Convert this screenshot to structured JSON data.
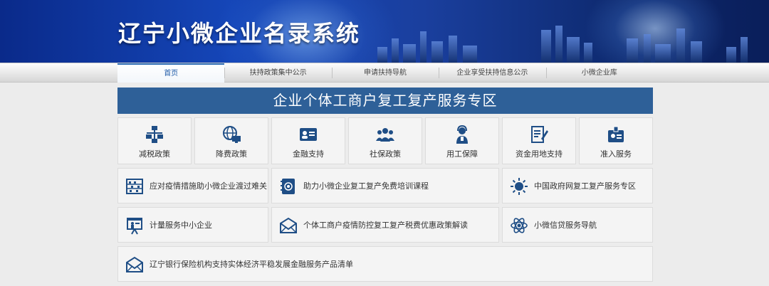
{
  "header": {
    "title": "辽宁小微企业名录系统"
  },
  "nav": [
    {
      "label": "首页"
    },
    {
      "label": "扶持政策集中公示"
    },
    {
      "label": "申请扶持导航"
    },
    {
      "label": "企业享受扶持信息公示"
    },
    {
      "label": "小微企业库"
    }
  ],
  "active_nav": "首页",
  "section": {
    "title": "企业个体工商户复工复产服务专区"
  },
  "services": [
    {
      "label": "减税政策",
      "icon": "network-computers-icon"
    },
    {
      "label": "降费政策",
      "icon": "globe-computer-icon"
    },
    {
      "label": "金融支持",
      "icon": "id-card-icon"
    },
    {
      "label": "社保政策",
      "icon": "people-group-icon"
    },
    {
      "label": "用工保障",
      "icon": "worker-headset-icon"
    },
    {
      "label": "资金用地支持",
      "icon": "document-edit-icon"
    },
    {
      "label": "准入服务",
      "icon": "badge-icon"
    }
  ],
  "links": [
    {
      "label": "应对疫情措施助小微企业渡过难关",
      "icon": "abacus-icon"
    },
    {
      "label": "助力小微企业复工复产免费培训课程",
      "icon": "address-book-icon"
    },
    {
      "label": "中国政府网复工复产服务专区",
      "icon": "sun-icon"
    },
    {
      "label": "计量服务中小企业",
      "icon": "presentation-board-icon"
    },
    {
      "label": "个体工商户疫情防控复工复产税费优惠政策解读",
      "icon": "envelope-icon"
    },
    {
      "label": "小微信贷服务导航",
      "icon": "atom-icon"
    },
    {
      "label": "辽宁银行保险机构支持实体经济平稳发展金融服务产品清单",
      "icon": "envelope-icon"
    }
  ],
  "colors": {
    "banner": "#1546b8",
    "header_bar": "#2e6098",
    "icon": "#1f4e86",
    "active_nav": "#1e5aa8"
  }
}
